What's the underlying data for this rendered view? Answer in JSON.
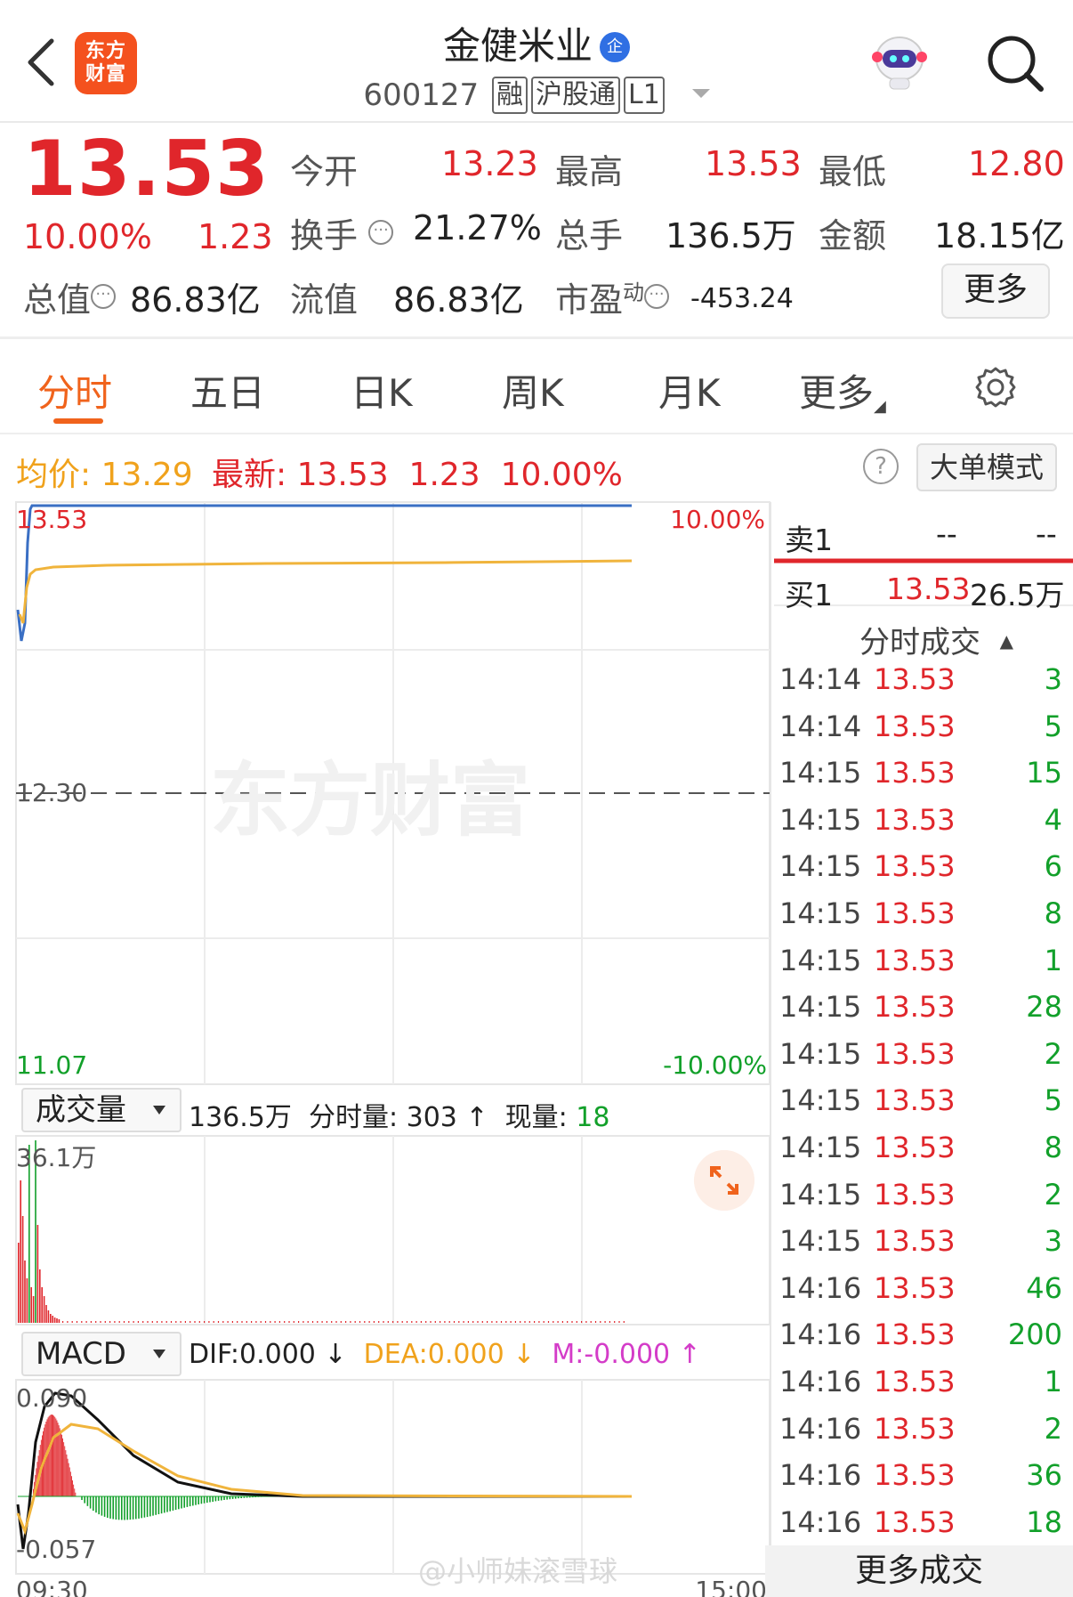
{
  "header": {
    "logo_line1": "东方",
    "logo_line2": "财富",
    "stock_name": "金健米业",
    "verify_badge": "企",
    "code": "600127",
    "tags": [
      "融",
      "沪股通",
      "L1"
    ]
  },
  "quote": {
    "price": "13.53",
    "change_pct": "10.00%",
    "change": "1.23",
    "open_label": "今开",
    "open": "13.23",
    "high_label": "最高",
    "high": "13.53",
    "low_label": "最低",
    "low": "12.80",
    "turnover_label": "换手",
    "turnover": "21.27%",
    "volume_label": "总手",
    "volume": "136.5万",
    "amount_label": "金额",
    "amount": "18.15亿",
    "mktcap_label": "总值",
    "mktcap": "86.83亿",
    "float_label": "流值",
    "float": "86.83亿",
    "pe_label": "市盈",
    "pe_sup": "动",
    "pe": "-453.24",
    "more_label": "更多"
  },
  "tabs": [
    "分时",
    "五日",
    "日K",
    "周K",
    "月K",
    "更多"
  ],
  "infobar": {
    "avg_label": "均价:",
    "avg": "13.29",
    "latest_label": "最新:",
    "latest": "13.53",
    "latest_chg": "1.23",
    "latest_pct": "10.00%",
    "help": "?",
    "bigorder_label": "大单模式"
  },
  "price_chart": {
    "top_left": "13.53",
    "top_right": "10.00%",
    "mid_left": "12.30",
    "bottom_left": "11.07",
    "bottom_right": "-10.00%",
    "watermark": "东方财富"
  },
  "volume_bar": {
    "selector": "成交量",
    "total": "136.5万",
    "period_label": "分时量:",
    "period": "303 ↑",
    "current_label": "现量:",
    "current": "18",
    "max": "36.1万"
  },
  "macd_bar": {
    "selector": "MACD",
    "dif": "DIF:0.000 ↓",
    "dea": "DEA:0.000 ↓",
    "m": "M:-0.000 ↑",
    "top": "0.090",
    "bottom": "-0.057"
  },
  "time_axis": {
    "start": "09:30",
    "end": "15:00"
  },
  "orderbook": {
    "sell1_label": "卖1",
    "sell1_price": "--",
    "sell1_vol": "--",
    "buy1_label": "买1",
    "buy1_price": "13.53",
    "buy1_vol": "26.5万"
  },
  "trades_header": "分时成交",
  "trades": [
    {
      "time": "14:14",
      "price": "13.53",
      "vol": "3"
    },
    {
      "time": "14:14",
      "price": "13.53",
      "vol": "5"
    },
    {
      "time": "14:15",
      "price": "13.53",
      "vol": "15"
    },
    {
      "time": "14:15",
      "price": "13.53",
      "vol": "4"
    },
    {
      "time": "14:15",
      "price": "13.53",
      "vol": "6"
    },
    {
      "time": "14:15",
      "price": "13.53",
      "vol": "8"
    },
    {
      "time": "14:15",
      "price": "13.53",
      "vol": "1"
    },
    {
      "time": "14:15",
      "price": "13.53",
      "vol": "28"
    },
    {
      "time": "14:15",
      "price": "13.53",
      "vol": "2"
    },
    {
      "time": "14:15",
      "price": "13.53",
      "vol": "5"
    },
    {
      "time": "14:15",
      "price": "13.53",
      "vol": "8"
    },
    {
      "time": "14:15",
      "price": "13.53",
      "vol": "2"
    },
    {
      "time": "14:15",
      "price": "13.53",
      "vol": "3"
    },
    {
      "time": "14:16",
      "price": "13.53",
      "vol": "46"
    },
    {
      "time": "14:16",
      "price": "13.53",
      "vol": "200"
    },
    {
      "time": "14:16",
      "price": "13.53",
      "vol": "1"
    },
    {
      "time": "14:16",
      "price": "13.53",
      "vol": "2"
    },
    {
      "time": "14:16",
      "price": "13.53",
      "vol": "36"
    },
    {
      "time": "14:16",
      "price": "13.53",
      "vol": "18"
    }
  ],
  "more_trades_label": "更多成交",
  "bottom_watermark": "@小师妹滚雪球",
  "colors": {
    "up": "#e0262b",
    "down": "#12a02a",
    "accent": "#f0631c",
    "avg_line": "#f0b43c",
    "price_line": "#3a6fc4"
  }
}
